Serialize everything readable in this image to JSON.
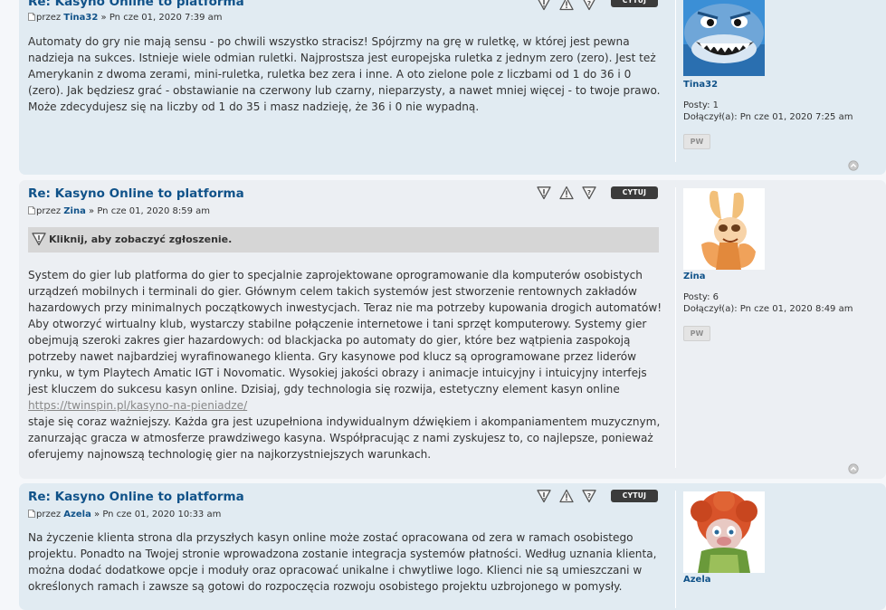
{
  "ui": {
    "quote_label": "CYTUJ",
    "pm_label": "PW",
    "by_prefix": "przez",
    "sep": " » ",
    "posts_label": "Posty:",
    "joined_label": "Dołączył(a):"
  },
  "posts": [
    {
      "title": "Re: Kasyno Online to platforma",
      "author": "Tina32",
      "date": "Pn cze 01, 2020 7:39 am",
      "paragraphs": [
        "Automaty do gry nie mają sensu - po chwili wszystko stracisz! Spójrzmy na grę w ruletkę, w której jest pewna nadzieja na sukces. Istnieje wiele odmian ruletki. Najprostsza jest europejska ruletka z jednym zero (zero). Jest też Amerykanin z dwoma zerami, mini-ruletka, ruletka bez zera i inne. A oto zielone pole z liczbami od 1 do 36 i 0 (zero). Jak będziesz grać - obstawianie na czerwony lub czarny, nieparzysty, a nawet mniej więcej - to twoje prawo. Może zdecydujesz się na liczby od 1 do 35 i masz nadzieję, że 36 i 0 nie wypadną."
      ],
      "profile": {
        "name": "Tina32",
        "posts": "1",
        "joined": "Pn cze 01, 2020 7:25 am"
      }
    },
    {
      "title": "Re: Kasyno Online to platforma",
      "author": "Zina",
      "date": "Pn cze 01, 2020 8:59 am",
      "report_notice": "Kliknij, aby zobaczyć zgłoszenie.",
      "text_before_link": "System do gier lub platforma do gier to specjalnie zaprojektowane oprogramowanie dla komputerów osobistych urządzeń mobilnych i terminali do gier. Głównym celem takich systemów jest stworzenie rentownych zakładów hazardowych przy minimalnych początkowych inwestycjach. Teraz nie ma potrzeby kupowania drogich automatów! Aby otworzyć wirtualny klub, wystarczy stabilne połączenie internetowe i tani sprzęt komputerowy. Systemy gier obejmują szeroki zakres gier hazardowych: od blackjacka po automaty do gier, które bez wątpienia zaspokoją potrzeby nawet najbardziej wyrafinowanego klienta. Gry kasynowe pod klucz są oprogramowane przez liderów rynku, w tym Playtech Amatic IGT i Novomatic. Wysokiej jakości obrazy i animacje intuicyjny i intuicyjny interfejs jest kluczem do sukcesu kasyn online. Dzisiaj, gdy technologia się rozwija, estetyczny element kasyn online",
      "link": "https://twinspin.pl/kasyno-na-pieniadze/",
      "text_after_link": "staje się coraz ważniejszy. Każda gra jest uzupełniona indywidualnym dźwiękiem i akompaniamentem muzycznym, zanurzając gracza w atmosferze prawdziwego kasyna. Współpracując z nami zyskujesz to, co najlepsze, ponieważ oferujemy najnowszą technologię gier na najkorzystniejszych warunkach.",
      "profile": {
        "name": "Zina",
        "posts": "6",
        "joined": "Pn cze 01, 2020 8:49 am"
      }
    },
    {
      "title": "Re: Kasyno Online to platforma",
      "author": "Azela",
      "date": "Pn cze 01, 2020 10:33 am",
      "paragraphs": [
        "Na życzenie klienta strona dla przyszłych kasyn online może zostać opracowana od zera w ramach osobistego projektu. Ponadto na Twojej stronie wprowadzona zostanie integracja systemów płatności. Według uznania klienta, można dodać dodatkowe opcje i moduły oraz opracować unikalne i chwytliwe logo. Klienci nie są umieszczani w określonych ramach i zawsze są gotowi do rozpoczęcia rozwoju osobistego projektu uzbrojonego w pomysły."
      ],
      "profile": {
        "name": "Azela"
      }
    }
  ],
  "colors": {
    "link": "#105289",
    "post_bg_1": "#e1ebf2",
    "post_bg_2": "#eceff3",
    "quote_btn": "#3b3b3b"
  }
}
